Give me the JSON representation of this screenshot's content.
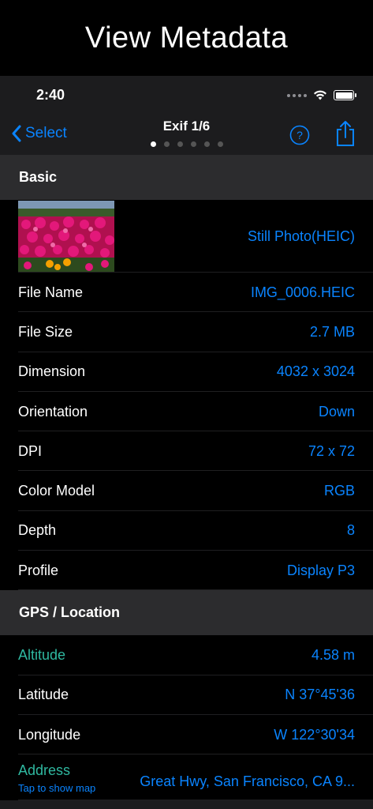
{
  "banner": {
    "title": "View Metadata"
  },
  "status": {
    "time": "2:40"
  },
  "nav": {
    "back_label": "Select",
    "title": "Exif 1/6",
    "page_count": 6,
    "active_page": 1,
    "accent_color": "#0a84ff"
  },
  "sections": {
    "basic": {
      "title": "Basic",
      "thumbnail_type": "Still Photo(HEIC)",
      "rows": [
        {
          "label": "File Name",
          "value": "IMG_0006.HEIC"
        },
        {
          "label": "File Size",
          "value": "2.7 MB"
        },
        {
          "label": "Dimension",
          "value": "4032 x 3024"
        },
        {
          "label": "Orientation",
          "value": "Down"
        },
        {
          "label": "DPI",
          "value": "72 x 72"
        },
        {
          "label": "Color Model",
          "value": "RGB"
        },
        {
          "label": "Depth",
          "value": "8"
        },
        {
          "label": "Profile",
          "value": "Display P3"
        }
      ]
    },
    "gps": {
      "title": "GPS / Location",
      "rows": [
        {
          "label": "Altitude",
          "value": "4.58 m"
        },
        {
          "label": "Latitude",
          "value": "N 37°45'36"
        },
        {
          "label": "Longitude",
          "value": "W 122°30'34"
        }
      ],
      "address": {
        "label": "Address",
        "hint": "Tap to show map",
        "value": "Great Hwy, San Francisco, CA  9..."
      }
    }
  },
  "icons": {
    "back": "chevron-left-icon",
    "help": "question-circle-icon",
    "share": "share-icon",
    "wifi": "wifi-icon",
    "battery": "battery-icon"
  }
}
